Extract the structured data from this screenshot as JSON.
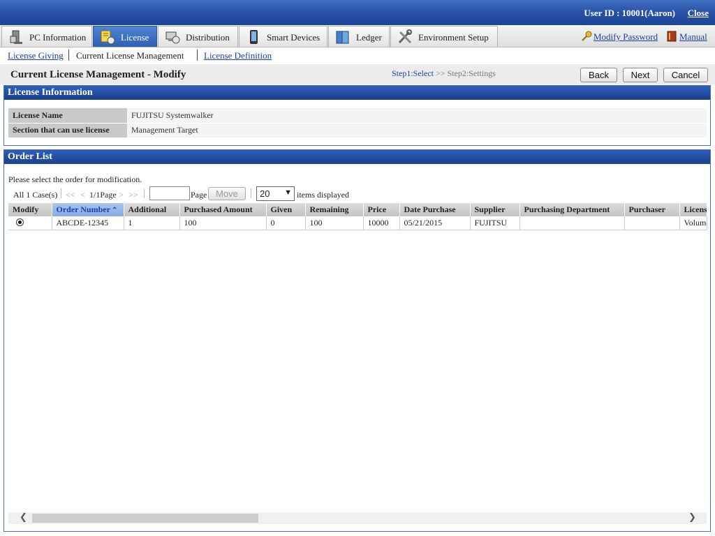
{
  "topbar": {
    "user_id": "User ID : 10001(Aaron)",
    "close_label": "Close"
  },
  "tabs": [
    {
      "label": "PC Information",
      "icon": "pc-icon",
      "active": false
    },
    {
      "label": "License",
      "icon": "license-icon",
      "active": true
    },
    {
      "label": "Distribution",
      "icon": "distribution-icon",
      "active": false
    },
    {
      "label": "Smart Devices",
      "icon": "smartphone-icon",
      "active": false
    },
    {
      "label": "Ledger",
      "icon": "ledger-icon",
      "active": false
    },
    {
      "label": "Environment Setup",
      "icon": "tools-icon",
      "active": false
    }
  ],
  "right_links": {
    "modify_password": "Modify Password",
    "manual": "Manual"
  },
  "subnav": {
    "license_giving": "License Giving",
    "current": "Current License Management",
    "license_definition": "License Definition"
  },
  "page": {
    "title": "Current License Management - Modify",
    "step1": "Step1:Select",
    "step_sep": ">>",
    "step2": "Step2:Settings",
    "back": "Back",
    "next": "Next",
    "cancel": "Cancel"
  },
  "license_info": {
    "header": "License Information",
    "rows": [
      {
        "key": "License Name",
        "value": "FUJITSU Systemwalker"
      },
      {
        "key": "Section that can use license",
        "value": "Management Target"
      }
    ]
  },
  "order_list": {
    "header": "Order List",
    "instruction": "Please select the order for modification.",
    "total": "All 1 Case(s)",
    "first": "<<",
    "prev": "<",
    "page_indicator": "1/1Page",
    "next": ">",
    "last": ">>",
    "page_label": "Page",
    "move": "Move",
    "page_size": "20",
    "items_displayed": "items displayed",
    "columns": [
      "Modify",
      "Order Number",
      "Additional",
      "Purchased Amount",
      "Given",
      "Remaining",
      "Price",
      "Date Purchase",
      "Supplier",
      "Purchasing Department",
      "Purchaser",
      "License"
    ],
    "row": {
      "order_number": "ABCDE-12345",
      "additional": "1",
      "purchased_amount": "100",
      "given": "0",
      "remaining": "100",
      "price": "10000",
      "date_purchase": "05/21/2015",
      "supplier": "FUJITSU",
      "purchasing_department": "",
      "purchaser": "",
      "license": "Volume"
    }
  },
  "colors": {
    "header_blue": "#2852a8",
    "link_blue": "#1a3fa6",
    "active_tab": "#3a6cc0"
  }
}
